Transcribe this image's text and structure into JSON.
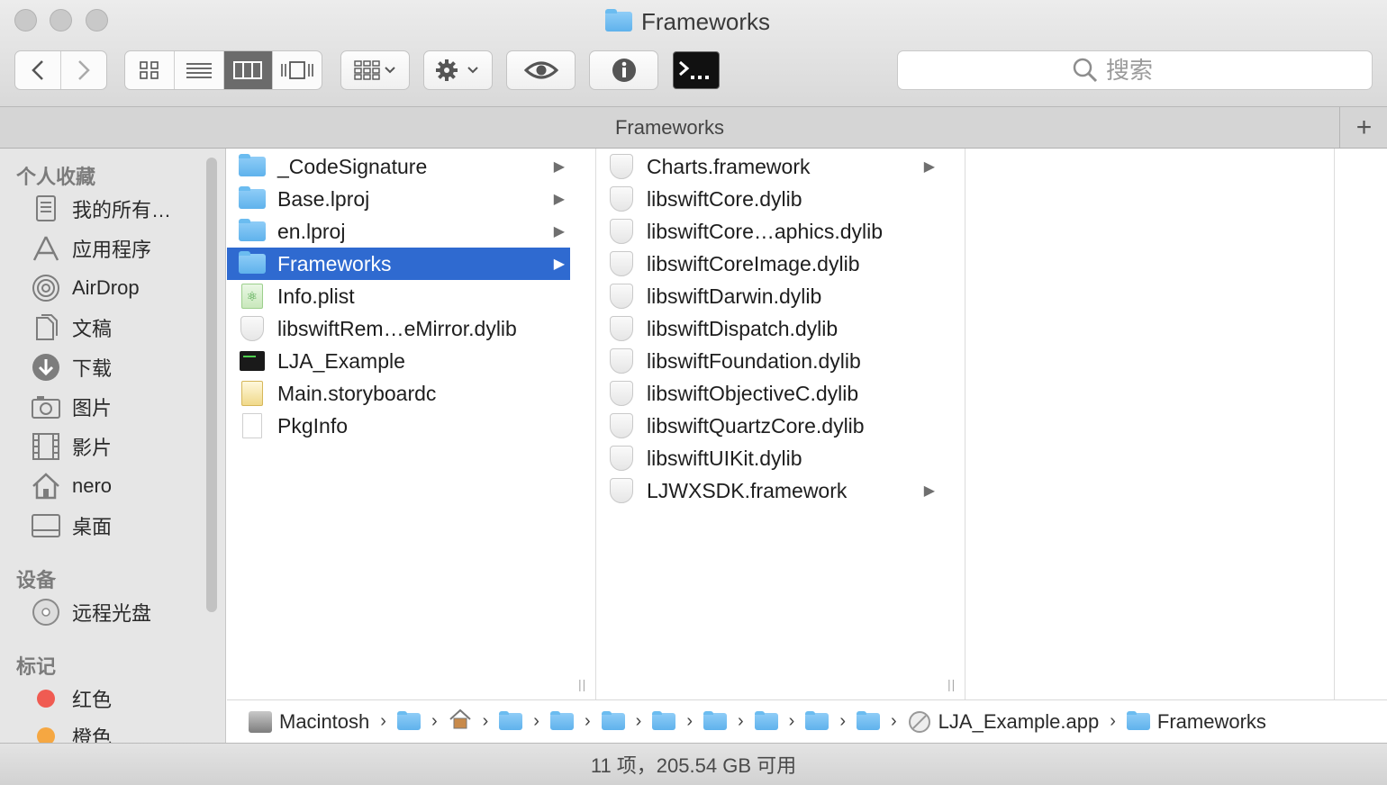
{
  "window": {
    "title": "Frameworks"
  },
  "toolbar": {
    "back_icon": "chevron-left-icon",
    "forward_icon": "chevron-right-icon",
    "view_modes": [
      "icon-view",
      "list-view",
      "column-view",
      "cover-flow-view"
    ],
    "active_view": "column-view",
    "search_placeholder": "搜索"
  },
  "tab": {
    "label": "Frameworks",
    "add_label": "+"
  },
  "sidebar": {
    "favorites_header": "个人收藏",
    "favorites": [
      {
        "label": "我的所有…",
        "icon": "all-files-icon"
      },
      {
        "label": "应用程序",
        "icon": "applications-icon"
      },
      {
        "label": "AirDrop",
        "icon": "airdrop-icon"
      },
      {
        "label": "文稿",
        "icon": "documents-icon"
      },
      {
        "label": "下载",
        "icon": "downloads-icon"
      },
      {
        "label": "图片",
        "icon": "pictures-icon"
      },
      {
        "label": "影片",
        "icon": "movies-icon"
      },
      {
        "label": "nero",
        "icon": "home-icon"
      },
      {
        "label": "桌面",
        "icon": "desktop-icon"
      }
    ],
    "devices_header": "设备",
    "devices": [
      {
        "label": "远程光盘",
        "icon": "remote-disc-icon"
      }
    ],
    "tags_header": "标记",
    "tags": [
      {
        "label": "红色",
        "color": "#f05b52"
      },
      {
        "label": "橙色",
        "color": "#f5a742"
      }
    ]
  },
  "columns": {
    "col1": [
      {
        "name": "_CodeSignature",
        "kind": "folder",
        "has_children": true
      },
      {
        "name": "Base.lproj",
        "kind": "folder",
        "has_children": true
      },
      {
        "name": "en.lproj",
        "kind": "folder",
        "has_children": true
      },
      {
        "name": "Frameworks",
        "kind": "folder",
        "has_children": true,
        "selected": true
      },
      {
        "name": "Info.plist",
        "kind": "plist",
        "has_children": false
      },
      {
        "name": "libswiftRem…eMirror.dylib",
        "kind": "dylib",
        "has_children": false
      },
      {
        "name": "LJA_Example",
        "kind": "exec",
        "has_children": false
      },
      {
        "name": "Main.storyboardc",
        "kind": "storyboard",
        "has_children": false
      },
      {
        "name": "PkgInfo",
        "kind": "doc",
        "has_children": false
      }
    ],
    "col2": [
      {
        "name": "Charts.framework",
        "kind": "dylib",
        "has_children": true
      },
      {
        "name": "libswiftCore.dylib",
        "kind": "dylib",
        "has_children": false
      },
      {
        "name": "libswiftCore…aphics.dylib",
        "kind": "dylib",
        "has_children": false
      },
      {
        "name": "libswiftCoreImage.dylib",
        "kind": "dylib",
        "has_children": false
      },
      {
        "name": "libswiftDarwin.dylib",
        "kind": "dylib",
        "has_children": false
      },
      {
        "name": "libswiftDispatch.dylib",
        "kind": "dylib",
        "has_children": false
      },
      {
        "name": "libswiftFoundation.dylib",
        "kind": "dylib",
        "has_children": false
      },
      {
        "name": "libswiftObjectiveC.dylib",
        "kind": "dylib",
        "has_children": false
      },
      {
        "name": "libswiftQuartzCore.dylib",
        "kind": "dylib",
        "has_children": false
      },
      {
        "name": "libswiftUIKit.dylib",
        "kind": "dylib",
        "has_children": false
      },
      {
        "name": "LJWXSDK.framework",
        "kind": "dylib",
        "has_children": true
      }
    ]
  },
  "pathbar": {
    "root": "Macintosh",
    "app": "LJA_Example.app",
    "current": "Frameworks"
  },
  "status": {
    "text": "11 项，205.54 GB 可用"
  },
  "colors": {
    "selection": "#2f6ad0",
    "folder": "#6bbcf0"
  }
}
